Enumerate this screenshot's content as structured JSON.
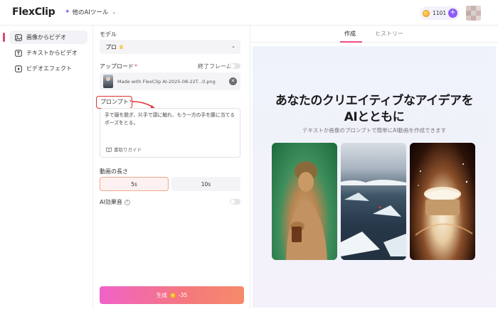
{
  "app": {
    "logo_text": "FlexClip",
    "tool_menu_label": "他のAIツール",
    "credits": "1101",
    "plus_label": "+"
  },
  "sidebar": {
    "items": [
      {
        "label": "画像からビデオ",
        "icon": "image-video-icon",
        "active": true
      },
      {
        "label": "テキストからビデオ",
        "icon": "text-video-icon",
        "active": false
      },
      {
        "label": "ビデオエフェクト",
        "icon": "video-effect-icon",
        "active": false
      }
    ]
  },
  "form": {
    "model_label": "モデル",
    "model_value": "プロ",
    "upload_label": "アップロード",
    "end_frame_label": "終了フレーム",
    "upload_filename": "Made with FlexClip AI-2025-08-22T...0.png",
    "prompt_label": "プロンプト",
    "prompt_text": "手で服を脱ぎ、片手で頭に触れ、もう一方の手を腰に当てるポーズをとる。",
    "guide_label": "書取りガイド",
    "duration_label": "動画の長さ",
    "duration_options": [
      "5s",
      "10s"
    ],
    "duration_selected": "5s",
    "sfx_label": "AI効果音",
    "sfx_help": "?",
    "generate_label": "生成",
    "generate_cost": "-35"
  },
  "preview": {
    "tabs": [
      "作成",
      "ヒストリー"
    ],
    "active_tab": "作成",
    "title_line1": "あなたのクリエイティブなアイデアを",
    "title_line2": "AIとともに",
    "subtitle": "テキストか画像のプロンプトで簡単にAI動画を作成できます"
  },
  "colors": {
    "accent_pink": "#ee4a8a",
    "accent_purple": "#8b5cf6",
    "annotation_red": "#e03030"
  }
}
